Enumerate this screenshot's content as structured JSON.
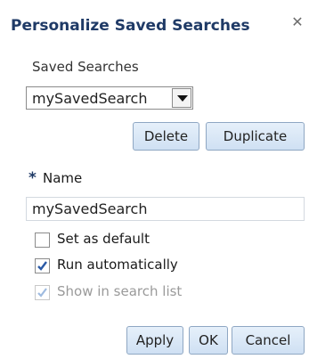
{
  "dialog": {
    "title": "Personalize Saved Searches",
    "close_icon": "close-icon"
  },
  "saved_searches": {
    "label": "Saved Searches",
    "selected": "mySavedSearch"
  },
  "actions": {
    "delete_label": "Delete",
    "duplicate_label": "Duplicate"
  },
  "name_field": {
    "required_marker": "*",
    "label": "Name",
    "value": "mySavedSearch"
  },
  "options": [
    {
      "label": "Set as default",
      "checked": false,
      "enabled": true
    },
    {
      "label": "Run automatically",
      "checked": true,
      "enabled": true
    },
    {
      "label": "Show in search list",
      "checked": true,
      "enabled": false
    }
  ],
  "footer": {
    "apply_label": "Apply",
    "ok_label": "OK",
    "cancel_label": "Cancel"
  },
  "colors": {
    "title": "#1f3a66",
    "button_fill": "#d9e7f6",
    "check_mark": "#2b5aa6"
  }
}
